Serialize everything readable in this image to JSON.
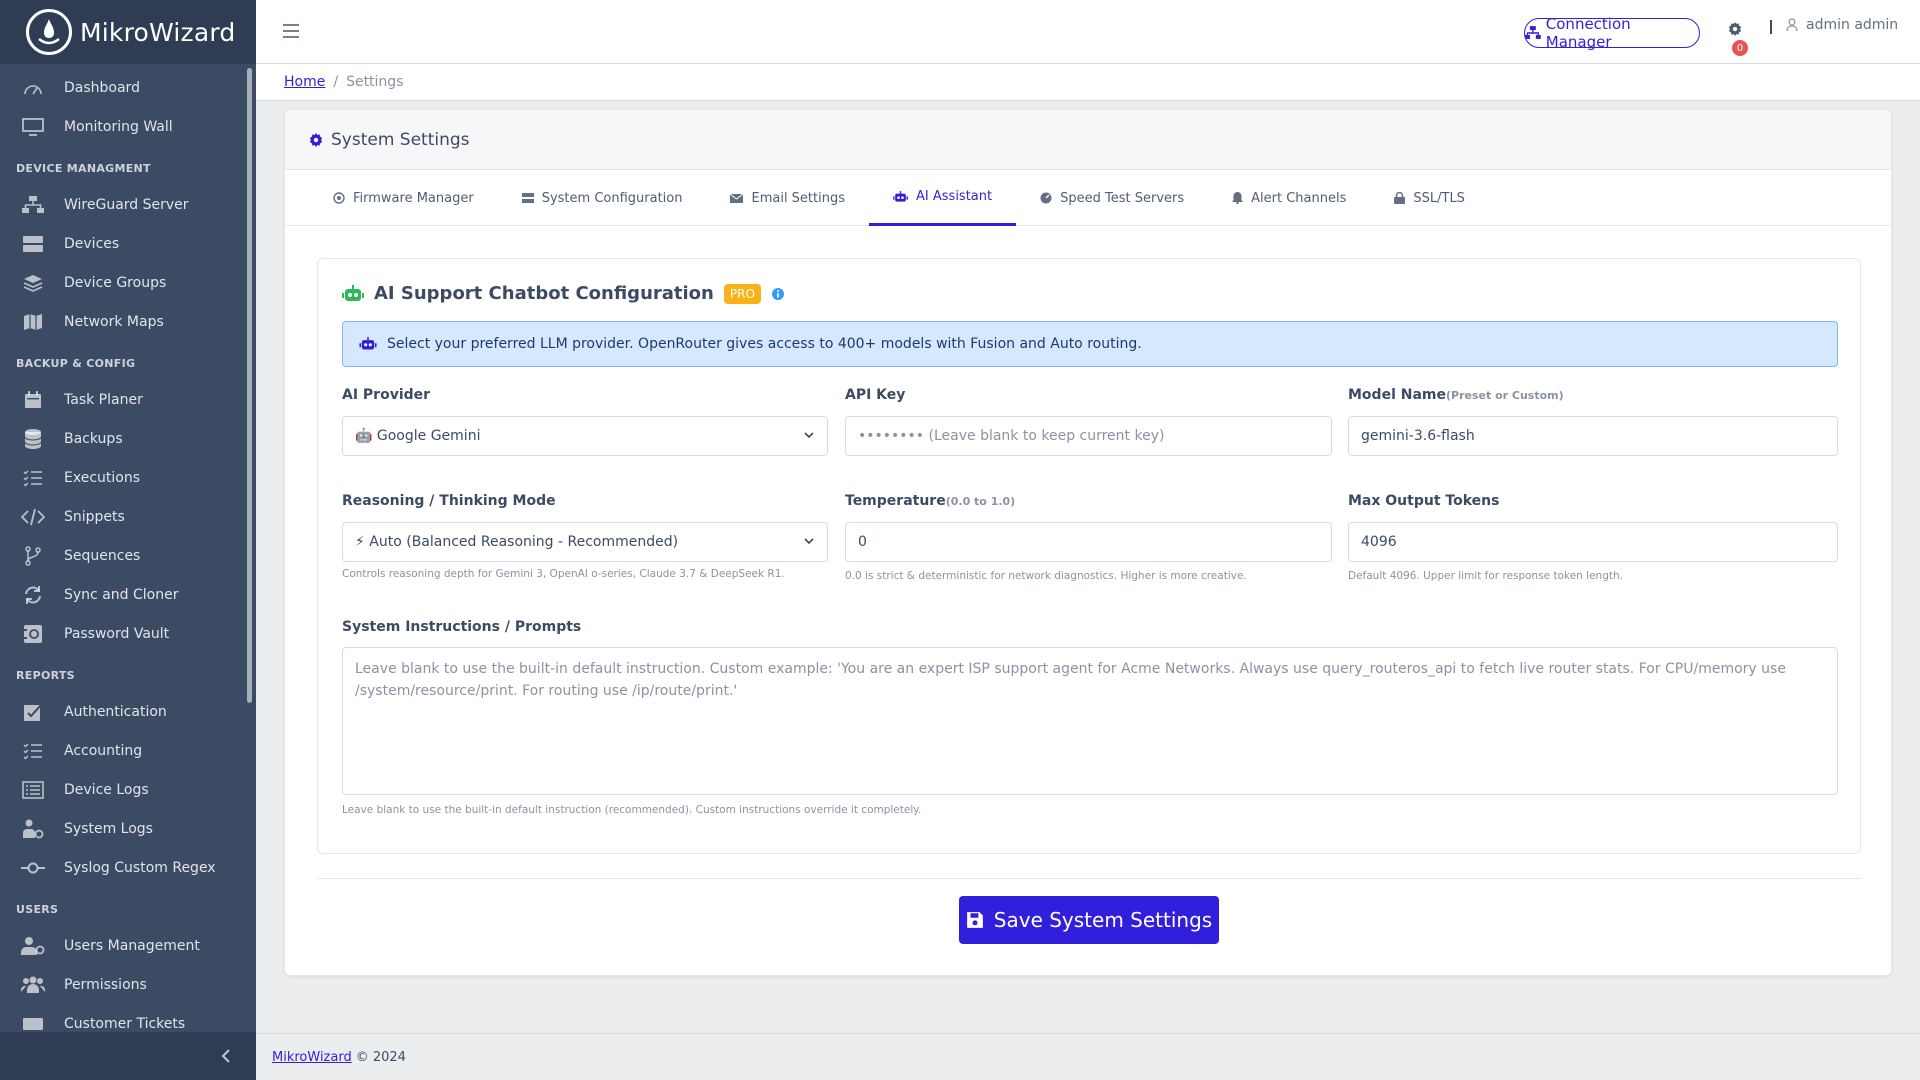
{
  "brand": {
    "name": "MikroWizard"
  },
  "sidebar": {
    "groups": [
      {
        "title": "",
        "items": [
          {
            "label": "Dashboard",
            "icon": "speedometer-icon"
          },
          {
            "label": "Monitoring Wall",
            "icon": "monitor-icon"
          }
        ]
      },
      {
        "title": "DEVICE MANAGMENT",
        "items": [
          {
            "label": "WireGuard Server",
            "icon": "lan-icon"
          },
          {
            "label": "Devices",
            "icon": "storage-icon"
          },
          {
            "label": "Device Groups",
            "icon": "layers-icon"
          },
          {
            "label": "Network Maps",
            "icon": "map-icon"
          }
        ]
      },
      {
        "title": "BACKUP & CONFIG",
        "items": [
          {
            "label": "Task Planer",
            "icon": "calendar-icon"
          },
          {
            "label": "Backups",
            "icon": "database-icon"
          },
          {
            "label": "Executions",
            "icon": "list-check-icon"
          },
          {
            "label": "Snippets",
            "icon": "code-icon"
          },
          {
            "label": "Sequences",
            "icon": "branch-icon"
          },
          {
            "label": "Sync and Cloner",
            "icon": "sync-icon"
          },
          {
            "label": "Password Vault",
            "icon": "vault-icon"
          }
        ]
      },
      {
        "title": "REPORTS",
        "items": [
          {
            "label": "Authentication",
            "icon": "check-box-icon"
          },
          {
            "label": "Accounting",
            "icon": "list-check-icon"
          },
          {
            "label": "Device Logs",
            "icon": "list-icon"
          },
          {
            "label": "System Logs",
            "icon": "user-gear-icon"
          },
          {
            "label": "Syslog Custom Regex",
            "icon": "commit-icon"
          }
        ]
      },
      {
        "title": "USERS",
        "items": [
          {
            "label": "Users Management",
            "icon": "users-gear-icon"
          },
          {
            "label": "Permissions",
            "icon": "people-icon"
          },
          {
            "label": "Customer Tickets",
            "icon": "ticket-icon"
          }
        ]
      }
    ]
  },
  "header": {
    "connection_manager": "Connection Manager",
    "notifications_count": "0",
    "user_name": "admin admin"
  },
  "breadcrumb": {
    "home": "Home",
    "current": "Settings"
  },
  "card": {
    "title": "System Settings",
    "tabs": [
      {
        "label": "Firmware Manager",
        "icon": "firmware-icon",
        "active": false
      },
      {
        "label": "System Configuration",
        "icon": "server-icon",
        "active": false
      },
      {
        "label": "Email Settings",
        "icon": "envelope-icon",
        "active": false
      },
      {
        "label": "AI Assistant",
        "icon": "robot-icon",
        "active": true
      },
      {
        "label": "Speed Test Servers",
        "icon": "gauge-icon",
        "active": false
      },
      {
        "label": "Alert Channels",
        "icon": "bell-icon",
        "active": false
      },
      {
        "label": "SSL/TLS",
        "icon": "lock-icon",
        "active": false
      }
    ]
  },
  "ai": {
    "title": "AI Support Chatbot Configuration",
    "pro_badge": "PRO",
    "info": "Select your preferred LLM provider. OpenRouter gives access to 400+ models with Fusion and Auto routing.",
    "provider_label": "AI Provider",
    "provider_value": "🤖 Google Gemini",
    "api_key_label": "API Key",
    "api_key_placeholder": "•••••••• (Leave blank to keep current key)",
    "model_label": "Model Name",
    "model_hint": "(Preset or Custom)",
    "model_value": "gemini-3.6-flash",
    "reasoning_label": "Reasoning / Thinking Mode",
    "reasoning_value": "⚡ Auto (Balanced Reasoning - Recommended)",
    "reasoning_help": "Controls reasoning depth for Gemini 3, OpenAI o-series, Claude 3.7 & DeepSeek R1.",
    "temperature_label": "Temperature",
    "temperature_hint": "(0.0 to 1.0)",
    "temperature_value": "0",
    "temperature_help": "0.0 is strict & deterministic for network diagnostics. Higher is more creative.",
    "max_tokens_label": "Max Output Tokens",
    "max_tokens_value": "4096",
    "max_tokens_help": "Default 4096. Upper limit for response token length.",
    "instructions_label": "System Instructions / Prompts",
    "instructions_placeholder": "Leave blank to use the built-in default instruction. Custom example: 'You are an expert ISP support agent for Acme Networks. Always use query_routeros_api to fetch live router stats. For CPU/memory use /system/resource/print. For routing use /ip/route/print.'",
    "instructions_help": "Leave blank to use the built-in default instruction (recommended). Custom instructions override it completely.",
    "save_label": "Save System Settings"
  },
  "footer": {
    "link": "MikroWizard",
    "copyright": "© 2024"
  },
  "colors": {
    "primary": "#321fdb",
    "sidebar": "#3c4b64",
    "pro": "#f9b115",
    "danger": "#e55353",
    "success": "#2eb85c"
  }
}
